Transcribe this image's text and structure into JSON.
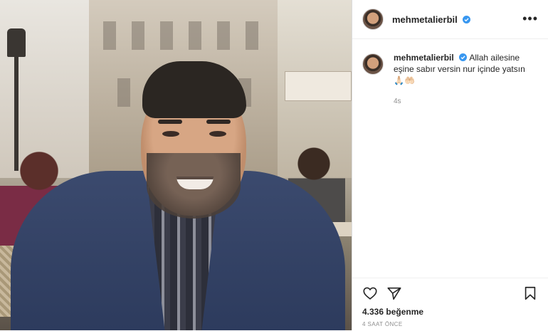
{
  "post": {
    "username": "mehmetalierbil",
    "verified": true,
    "more_icon": "more-horizontal-icon",
    "photo_alt_icon": "post-photo"
  },
  "comment": {
    "username": "mehmetalierbil",
    "text": "Allah ailesine eşine sabır versin nur içinde yatsın 🙏🏻🤲🏻",
    "time_ago": "4s"
  },
  "actions": {
    "like_icon": "heart-icon",
    "share_icon": "send-icon",
    "save_icon": "bookmark-icon"
  },
  "likes": "4.336 beğenme",
  "posted": "4 SAAT ÖNCE",
  "colors": {
    "verified": "#3897f0",
    "text": "#262626",
    "muted": "#8e8e8e",
    "border": "#dbdbdb"
  }
}
